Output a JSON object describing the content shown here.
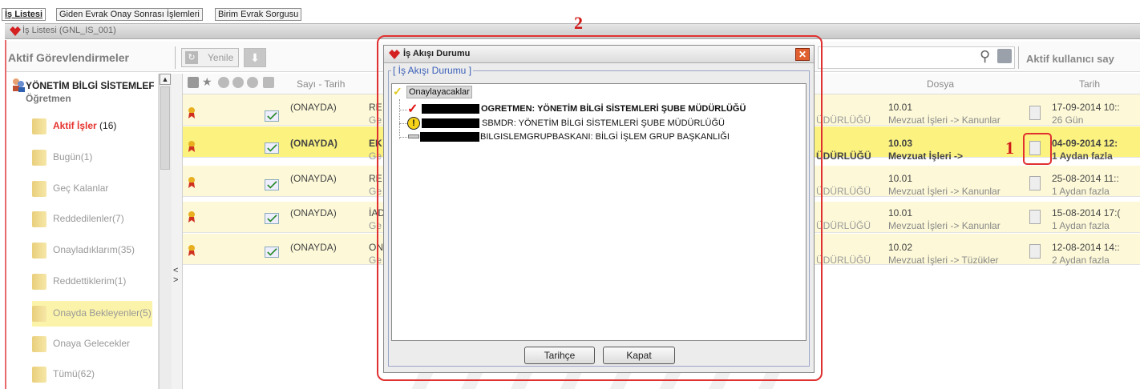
{
  "tabs": [
    "İş Listesi",
    "Giden Evrak Onay Sonrası İşlemleri",
    "Birim Evrak Sorgusu"
  ],
  "panel_title": "İş Listesi (GNL_IS_001)",
  "toolbar": {
    "left_title": "Aktif Görevlendirmeler",
    "refresh_label": "Yenile",
    "right_title": "Aktif kullanıcı say"
  },
  "user": {
    "name": "YÖNETİM BİLGİ SİSTEMLEF",
    "role": "Öğretmen"
  },
  "sidebar_items": [
    {
      "label": "Aktif İşler",
      "count": "(16)"
    },
    {
      "label": "Bugün(1)"
    },
    {
      "label": "Geç Kalanlar"
    },
    {
      "label": "Reddedilenler(7)"
    },
    {
      "label": "Onayladıklarım(35)"
    },
    {
      "label": "Reddettiklerim(1)"
    },
    {
      "label": "Onayda Bekleyenler(5)"
    },
    {
      "label": "Onaya Gelecekler"
    },
    {
      "label": "Tümü(62)"
    }
  ],
  "table": {
    "headers": {
      "sayi_tarih": "Sayı - Tarih",
      "dosya": "Dosya",
      "tarih": "Tarih"
    },
    "rows": [
      {
        "status": "(ONAYDA)",
        "c1a": "RE",
        "c1b": "Ge",
        "unit": "ÜDÜRLÜĞÜ",
        "code": "10.01",
        "path": "Mevzuat İşleri -> Kanunlar",
        "date": "17-09-2014 10::",
        "age": "26 Gün"
      },
      {
        "status": "(ONAYDA)",
        "c1a": "EK",
        "c1b": "Ge",
        "unit": "ÜDÜRLÜĞÜ",
        "code": "10.03",
        "path": "Mevzuat İşleri ->",
        "date": "04-09-2014 12:",
        "age": "1 Aydan fazla"
      },
      {
        "status": "(ONAYDA)",
        "c1a": "RE",
        "c1b": "Ge",
        "unit": "ÜDÜRLÜĞÜ",
        "code": "10.01",
        "path": "Mevzuat İşleri -> Kanunlar",
        "date": "25-08-2014 11::",
        "age": "1 Aydan fazla"
      },
      {
        "status": "(ONAYDA)",
        "c1a": "İAD",
        "c1b": "Ge",
        "unit": "ÜDÜRLÜĞÜ",
        "code": "10.01",
        "path": "Mevzuat İşleri -> Kanunlar",
        "date": "15-08-2014 17:(",
        "age": "1 Aydan fazla"
      },
      {
        "status": "(ONAYDA)",
        "c1a": "ON",
        "c1b": "Ge",
        "unit": "ÜDÜRLÜĞÜ",
        "code": "10.02",
        "path": "Mevzuat İşleri -> Tüzükler",
        "date": "12-08-2014 14::",
        "age": "2 Aydan fazla"
      }
    ]
  },
  "dialog": {
    "title": "İş Akışı Durumu",
    "legend": "[ İş Akışı Durumu ]",
    "root": "Onaylayacaklar",
    "nodes": [
      {
        "text": "OGRETMEN: YÖNETİM BİLGİ SİSTEMLERİ ŞUBE MÜDÜRLÜĞÜ"
      },
      {
        "text": "SBMDR: YÖNETİM BİLGİ SİSTEMLERİ ŞUBE MÜDÜRLÜĞÜ"
      },
      {
        "text": "BILGISLEMGRUPBASKANI: BİLGİ İŞLEM GRUP BAŞKANLIĞI"
      }
    ],
    "btn_history": "Tarihçe",
    "btn_close": "Kapat"
  },
  "annotations": {
    "one": "1",
    "two": "2"
  },
  "colors": {
    "accent_red": "#e5322d",
    "annotation_red": "#e03030",
    "highlight_yellow": "#fbf27f",
    "legend_blue": "#3a5fb8"
  }
}
